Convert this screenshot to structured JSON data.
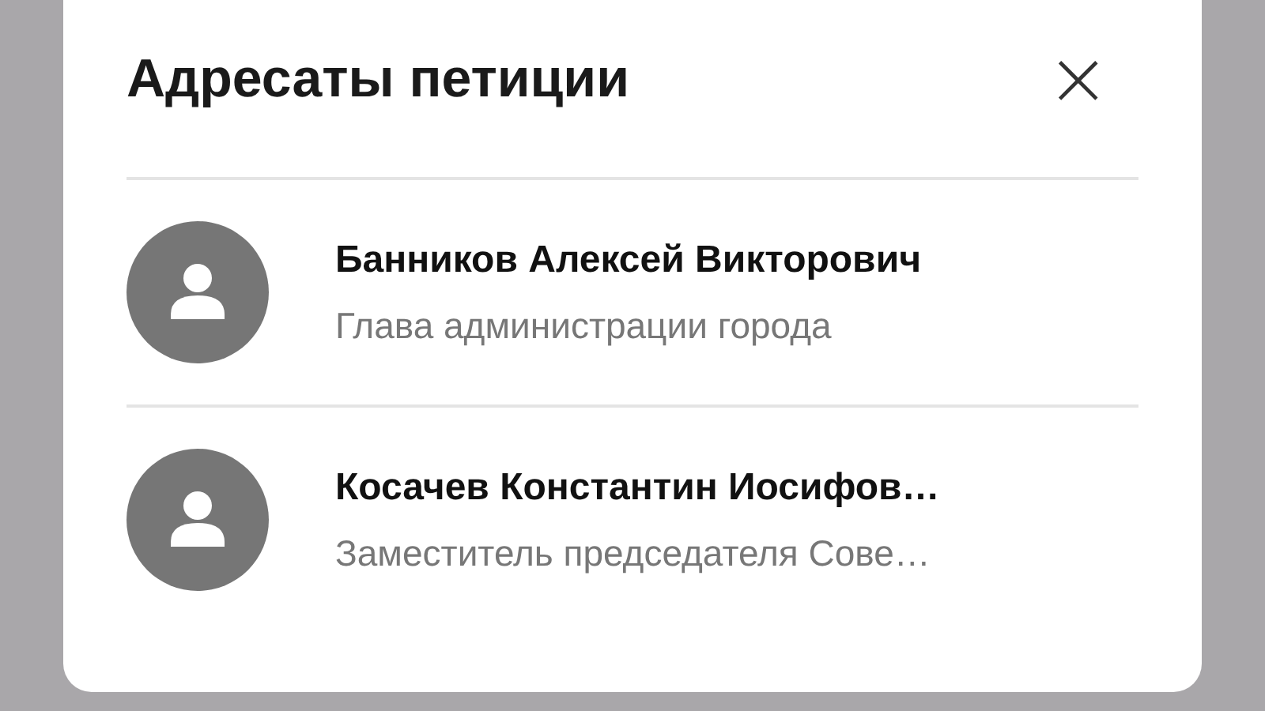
{
  "dialog": {
    "title": "Адресаты петиции",
    "close": "×"
  },
  "recipients": [
    {
      "name": "Банников Алексей Викторович",
      "position": "Глава администрации города"
    },
    {
      "name": "Косачев Константин Иосифов…",
      "position": "Заместитель председателя Сове…"
    }
  ]
}
